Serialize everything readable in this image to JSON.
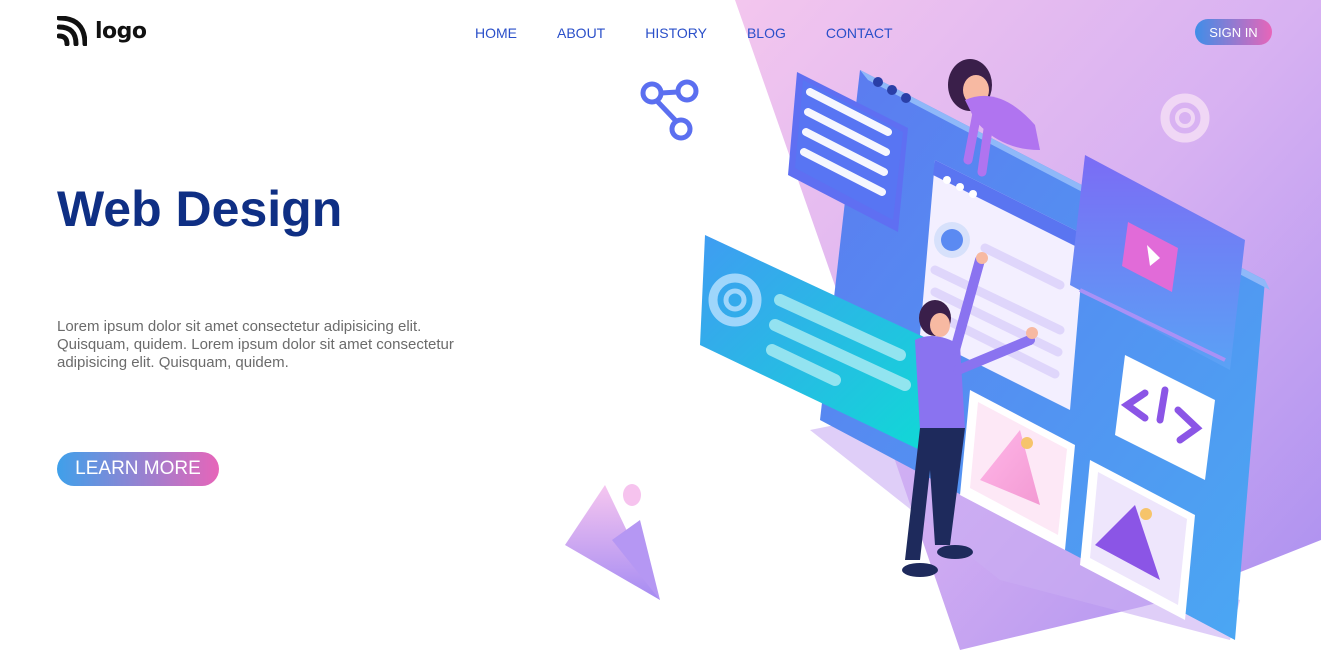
{
  "header": {
    "logo_text": "logo",
    "nav": [
      "HOME",
      "ABOUT",
      "HISTORY",
      "BLOG",
      "CONTACT"
    ],
    "signin_label": "SIGN IN"
  },
  "hero": {
    "title": "Web Design",
    "text": "Lorem ipsum dolor sit amet consectetur adipisicing elit. Quisquam, quidem. Lorem ipsum dolor sit amet consectetur adipisicing elit. Quisquam, quidem.",
    "cta_label": "LEARN MORE"
  },
  "colors": {
    "title": "#0f2f84",
    "nav": "#2a4fc9",
    "gradient_start": "#3f8ee8",
    "gradient_end": "#e765b9",
    "background_shape": "#c9a8f0"
  },
  "illustration": {
    "icons": [
      "share-icon",
      "gear-icon",
      "code-icon",
      "image-icon",
      "play-icon"
    ]
  }
}
